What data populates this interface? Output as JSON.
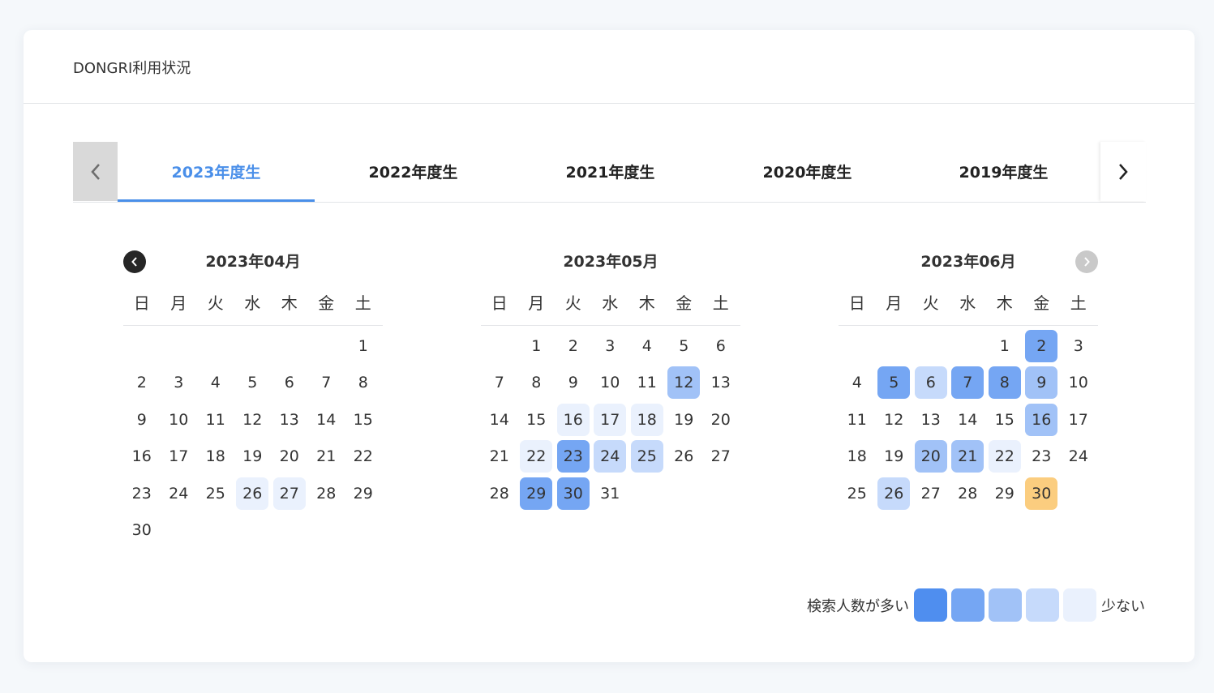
{
  "header": {
    "title": "DONGRI利用状況"
  },
  "tabs": [
    {
      "label": "2023年度生",
      "active": true
    },
    {
      "label": "2022年度生",
      "active": false
    },
    {
      "label": "2021年度生",
      "active": false
    },
    {
      "label": "2020年度生",
      "active": false
    },
    {
      "label": "2019年度生",
      "active": false
    }
  ],
  "weekdays": [
    "日",
    "月",
    "火",
    "水",
    "木",
    "金",
    "土"
  ],
  "calendars": [
    {
      "title": "2023年04月",
      "first_weekday": 6,
      "days_in_month": 30,
      "levels": {
        "26": 1,
        "27": 1
      },
      "today": null
    },
    {
      "title": "2023年05月",
      "first_weekday": 1,
      "days_in_month": 31,
      "levels": {
        "12": 3,
        "16": 1,
        "17": 1,
        "18": 1,
        "22": 1,
        "23": 4,
        "24": 2,
        "25": 2,
        "29": 4,
        "30": 4
      },
      "today": null
    },
    {
      "title": "2023年06月",
      "first_weekday": 4,
      "days_in_month": 30,
      "levels": {
        "2": 4,
        "5": 4,
        "6": 2,
        "7": 4,
        "8": 4,
        "9": 3,
        "16": 3,
        "20": 3,
        "21": 3,
        "22": 1,
        "26": 2
      },
      "today": 30
    }
  ],
  "legend": {
    "high_label": "検索人数が多い",
    "low_label": "少ない",
    "colors": [
      "#4f8eef",
      "#75a6f3",
      "#a1c2f7",
      "#c6dafb",
      "#eaf1fd"
    ]
  },
  "colors": {
    "accent": "#4a8fe9",
    "today": "#fbcd7f"
  },
  "icons": {
    "tab_prev": "chevron-left-icon",
    "tab_next": "chevron-right-icon",
    "month_prev": "chevron-left-icon",
    "month_next": "chevron-right-icon"
  }
}
